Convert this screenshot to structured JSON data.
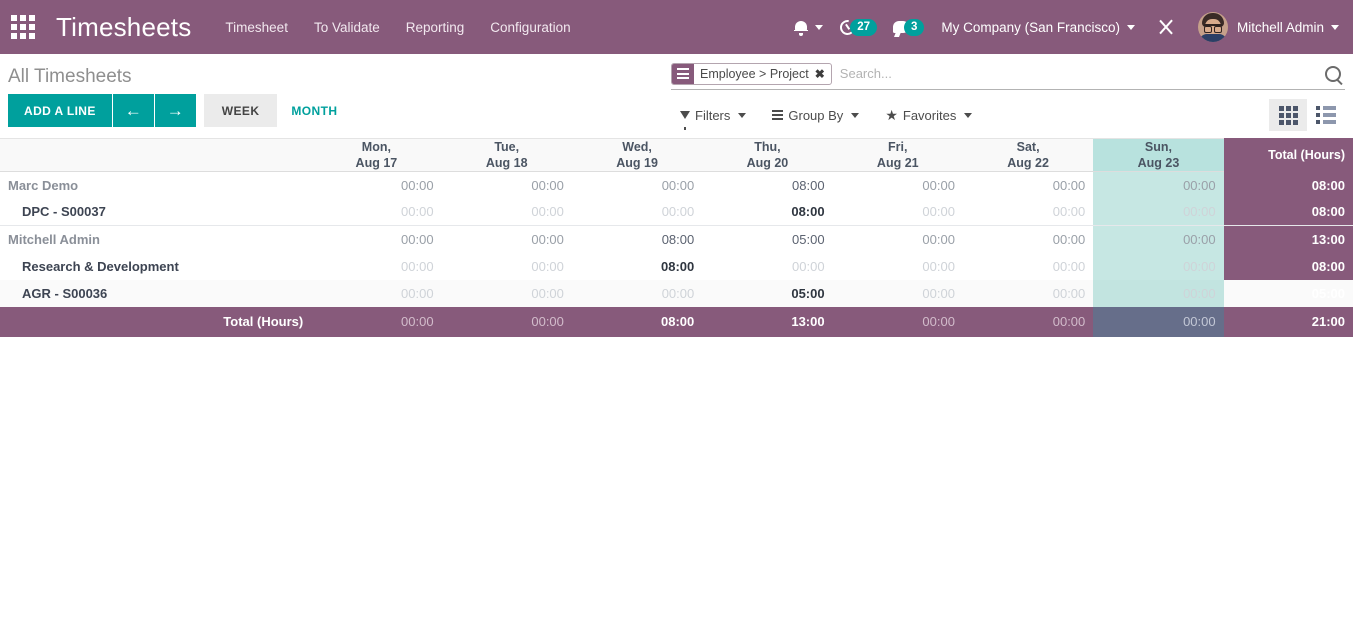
{
  "navbar": {
    "apps_icon": "apps-grid-icon",
    "brand": "Timesheets",
    "menu": [
      {
        "label": "Timesheet"
      },
      {
        "label": "To Validate"
      },
      {
        "label": "Reporting"
      },
      {
        "label": "Configuration"
      }
    ],
    "bell_icon": "bell-icon",
    "timer_icon": "timer-icon",
    "timer_count": "27",
    "chat_icon": "chat-icon",
    "chat_count": "3",
    "company": "My Company (San Francisco)",
    "wrench_icon": "wrench-icon",
    "user": "Mitchell Admin",
    "accent_purple": "#875a7b",
    "accent_teal": "#00a09d"
  },
  "control": {
    "breadcrumb": "All Timesheets",
    "add_line": "ADD A LINE",
    "prev_arrow": "←",
    "next_arrow": "→",
    "week": "WEEK",
    "month": "MONTH",
    "search": {
      "facet_label": "Employee > Project",
      "facet_close": "✖",
      "placeholder": "Search...",
      "value": ""
    },
    "filters": "Filters",
    "group_by": "Group By",
    "favorites": "Favorites",
    "view_grid": "grid-view-icon",
    "view_list": "list-view-icon"
  },
  "grid": {
    "columns": [
      {
        "day": "Mon,",
        "date": "Aug 17",
        "weekend": false
      },
      {
        "day": "Tue,",
        "date": "Aug 18",
        "weekend": false
      },
      {
        "day": "Wed,",
        "date": "Aug 19",
        "weekend": false
      },
      {
        "day": "Thu,",
        "date": "Aug 20",
        "weekend": false
      },
      {
        "day": "Fri,",
        "date": "Aug 21",
        "weekend": false
      },
      {
        "day": "Sat,",
        "date": "Aug 22",
        "weekend": false
      },
      {
        "day": "Sun,",
        "date": "Aug 23",
        "weekend": true
      }
    ],
    "total_header": "Total (Hours)",
    "rows": [
      {
        "label": "Marc Demo",
        "type": "group",
        "values": [
          "00:00",
          "00:00",
          "00:00",
          "08:00",
          "00:00",
          "00:00",
          "00:00"
        ],
        "total": "08:00"
      },
      {
        "label": "DPC - S00037",
        "type": "child",
        "values": [
          "00:00",
          "00:00",
          "00:00",
          "08:00",
          "00:00",
          "00:00",
          "00:00"
        ],
        "total": "08:00"
      },
      {
        "label": "Mitchell Admin",
        "type": "group",
        "values": [
          "00:00",
          "00:00",
          "08:00",
          "05:00",
          "00:00",
          "00:00",
          "00:00"
        ],
        "total": "13:00"
      },
      {
        "label": "Research & Development",
        "type": "child",
        "values": [
          "00:00",
          "00:00",
          "08:00",
          "00:00",
          "00:00",
          "00:00",
          "00:00"
        ],
        "total": "08:00"
      },
      {
        "label": "AGR - S00036",
        "type": "child",
        "values": [
          "00:00",
          "00:00",
          "00:00",
          "05:00",
          "00:00",
          "00:00",
          "00:00"
        ],
        "total": "05:00"
      }
    ],
    "footer": {
      "label": "Total (Hours)",
      "values": [
        "00:00",
        "00:00",
        "08:00",
        "13:00",
        "00:00",
        "00:00",
        "00:00"
      ],
      "total": "21:00"
    },
    "colors": {
      "header_purple": "#875a7b",
      "weekend_teal": "#b8e2de",
      "weekend_total": "#666e8a"
    }
  }
}
